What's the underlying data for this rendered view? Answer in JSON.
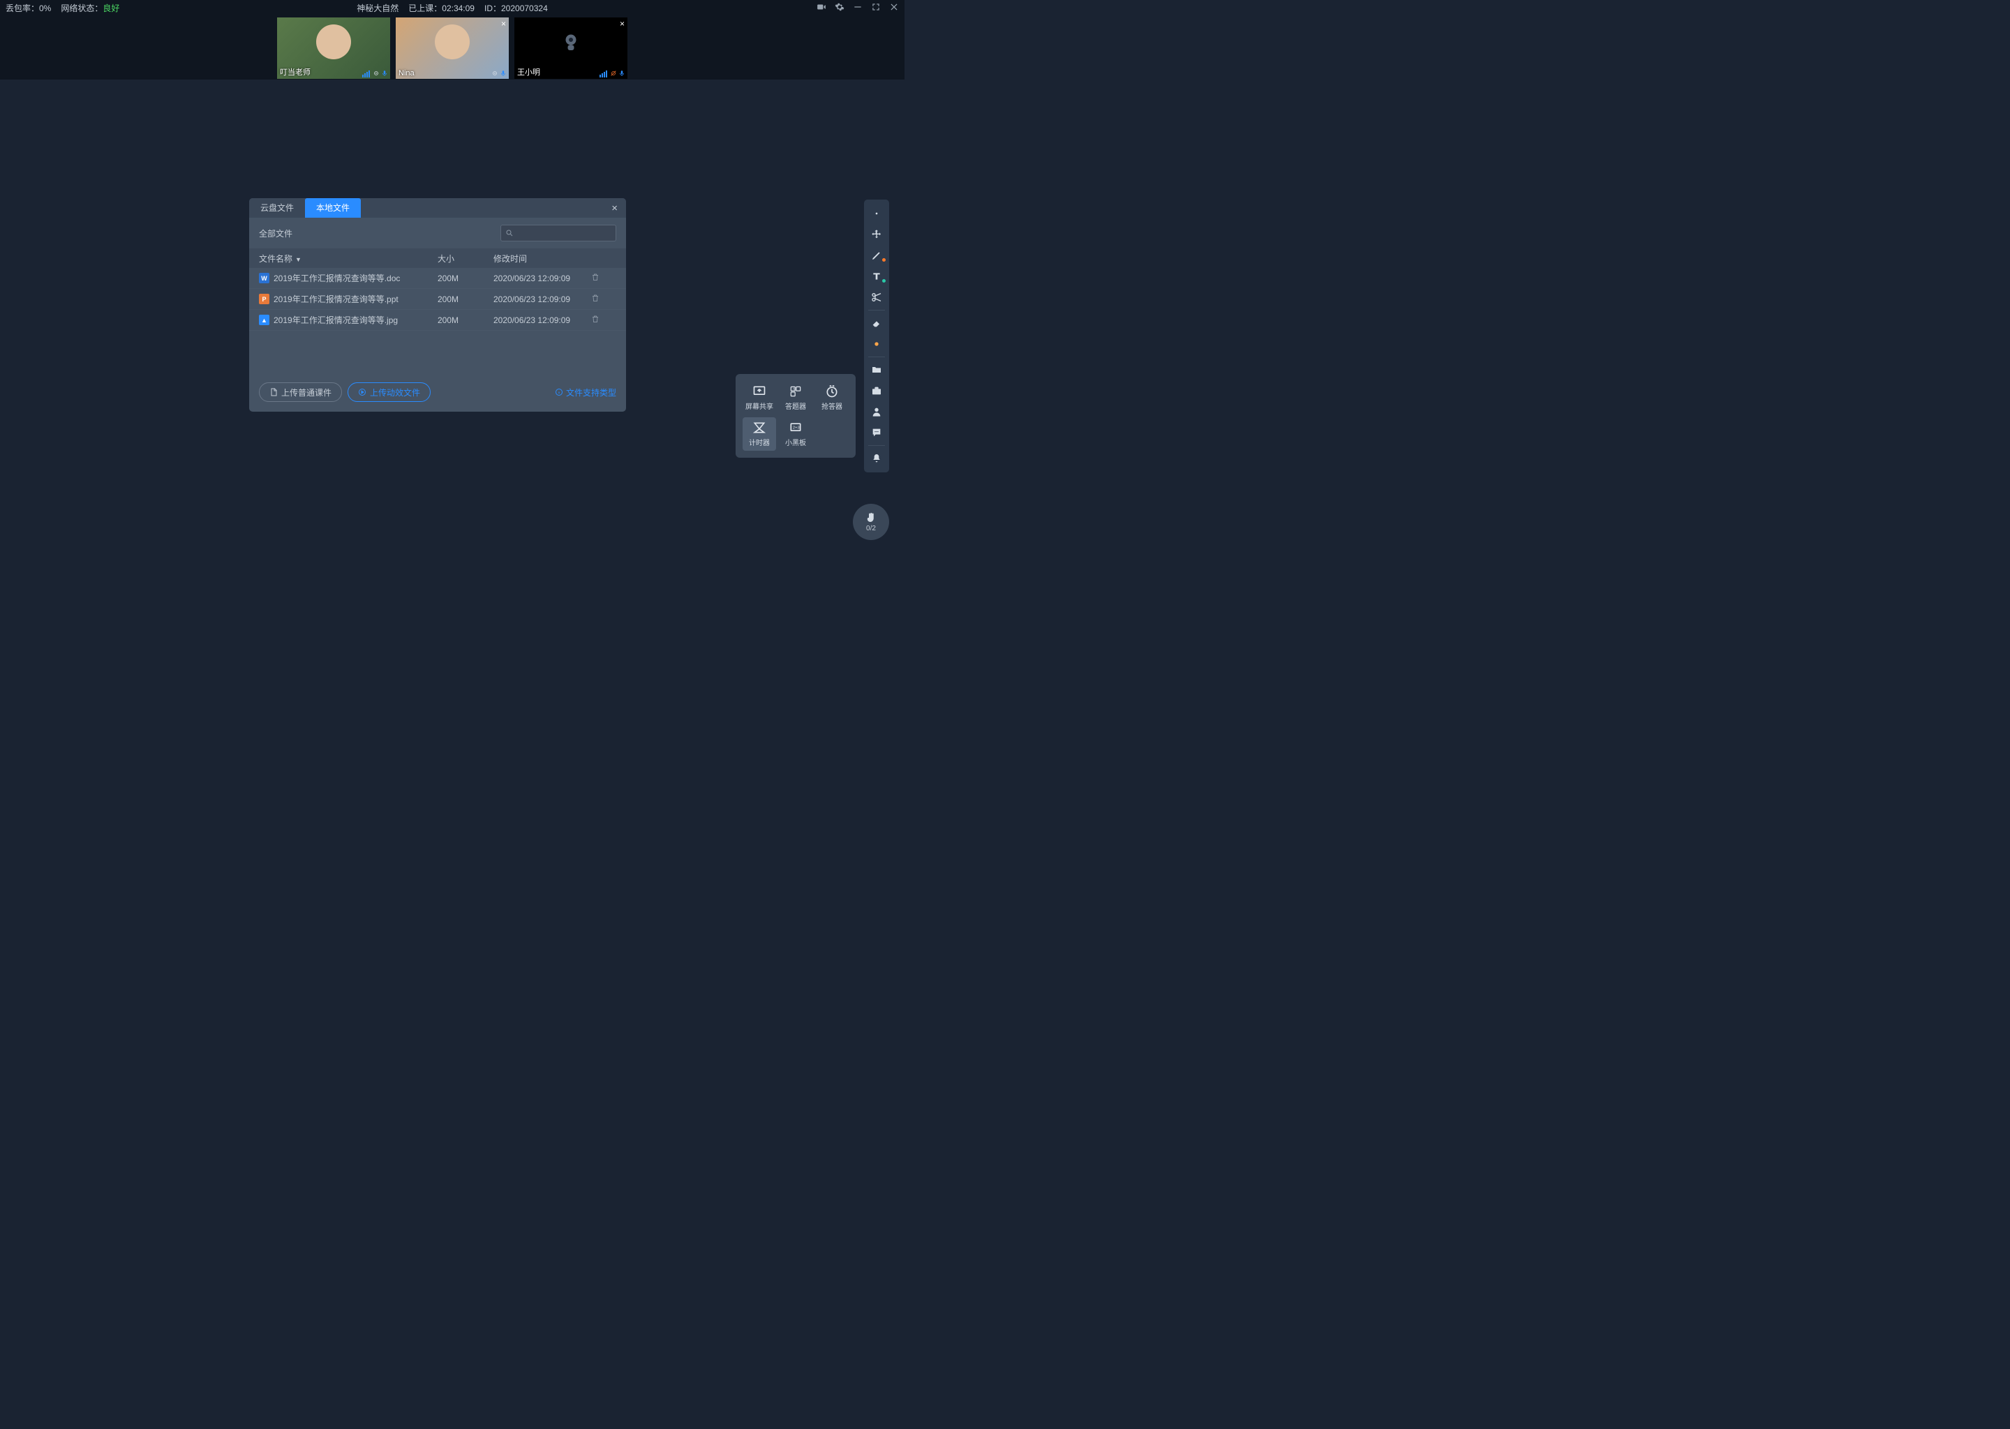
{
  "topbar": {
    "packet_loss_label": "丢包率：0%",
    "network_label": "网络状态：",
    "network_value": "良好",
    "class_title": "神秘大自然",
    "duration_label": "已上课：",
    "duration_value": "02:34:09",
    "id_label": "ID：",
    "id_value": "2020070324"
  },
  "participants": [
    {
      "name": "叮当老师"
    },
    {
      "name": "Nina"
    },
    {
      "name": "王小明"
    }
  ],
  "dialog": {
    "tab_cloud": "云盘文件",
    "tab_local": "本地文件",
    "crumb": "全部文件",
    "columns": {
      "name": "文件名称",
      "size": "大小",
      "time": "修改时间"
    },
    "files": [
      {
        "icon": "doc",
        "name": "2019年工作汇报情况查询等等.doc",
        "size": "200M",
        "time": "2020/06/23 12:09:09"
      },
      {
        "icon": "ppt",
        "name": "2019年工作汇报情况查询等等.ppt",
        "size": "200M",
        "time": "2020/06/23 12:09:09"
      },
      {
        "icon": "img",
        "name": "2019年工作汇报情况查询等等.jpg",
        "size": "200M",
        "time": "2020/06/23 12:09:09"
      }
    ],
    "btn_upload_plain": "上传普通课件",
    "btn_upload_anim": "上传动效文件",
    "support_link": "文件支持类型"
  },
  "tools_popup": {
    "screen_share": "屏幕共享",
    "answer_tool": "答题器",
    "grab_answer": "抢答器",
    "timer": "计时器",
    "small_board": "小黑板"
  },
  "hand": {
    "count": "0/2"
  }
}
